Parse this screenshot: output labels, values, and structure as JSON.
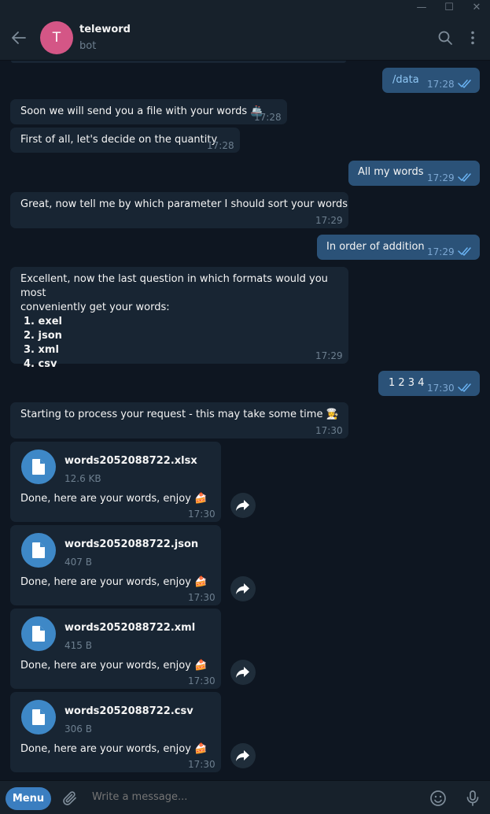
{
  "window": {
    "minimize": "—",
    "maximize": "☐",
    "close": "✕"
  },
  "chat": {
    "name": "teleword",
    "status": "bot",
    "avatar_letter": "T",
    "avatar_color": "#d45686"
  },
  "messages": [
    {
      "dir": "out",
      "text": "/data",
      "time": "17:28"
    },
    {
      "dir": "in",
      "text": "Soon we will send you a file with your words 🚢",
      "time": "17:28"
    },
    {
      "dir": "in",
      "text": "First of all, let's decide on the quantity",
      "time": "17:28"
    },
    {
      "dir": "out",
      "text": "All my words",
      "time": "17:29"
    },
    {
      "dir": "in",
      "text": "Great, now tell me by which parameter I should sort your words",
      "time": "17:29"
    },
    {
      "dir": "out",
      "text": "In order of addition",
      "time": "17:29"
    },
    {
      "dir": "in",
      "text_line1": "Excellent, now the last question in which formats would you most",
      "text_line2": "conveniently get your words:",
      "list": [
        "1. exel",
        "2. json",
        "3. xml",
        "4. csv"
      ],
      "time": "17:29"
    },
    {
      "dir": "out",
      "text": "1 2 3 4",
      "time": "17:30"
    },
    {
      "dir": "in",
      "text": "Starting to process your request - this may take some time 👩‍🍳",
      "time": "17:30"
    }
  ],
  "files": [
    {
      "name": "words2052088722.xlsx",
      "size": "12.6 KB",
      "caption": "Done, here are your words, enjoy 🍰",
      "time": "17:30"
    },
    {
      "name": "words2052088722.json",
      "size": "407 B",
      "caption": "Done, here are your words, enjoy 🍰",
      "time": "17:30"
    },
    {
      "name": "words2052088722.xml",
      "size": "415 B",
      "caption": "Done, here are your words, enjoy 🍰",
      "time": "17:30"
    },
    {
      "name": "words2052088722.csv",
      "size": "306 B",
      "caption": "Done, here are your words, enjoy 🍰",
      "time": "17:30"
    }
  ],
  "composer": {
    "menu_label": "Menu",
    "placeholder": "Write a message..."
  },
  "colors": {
    "background": "#0e1621",
    "incoming": "#182533",
    "outgoing": "#2b5278",
    "accent": "#3e88c7"
  },
  "icons": [
    "back-arrow-icon",
    "search-icon",
    "more-vertical-icon",
    "read-checks-icon",
    "document-icon",
    "forward-icon",
    "paperclip-icon",
    "emoji-icon",
    "microphone-icon"
  ]
}
